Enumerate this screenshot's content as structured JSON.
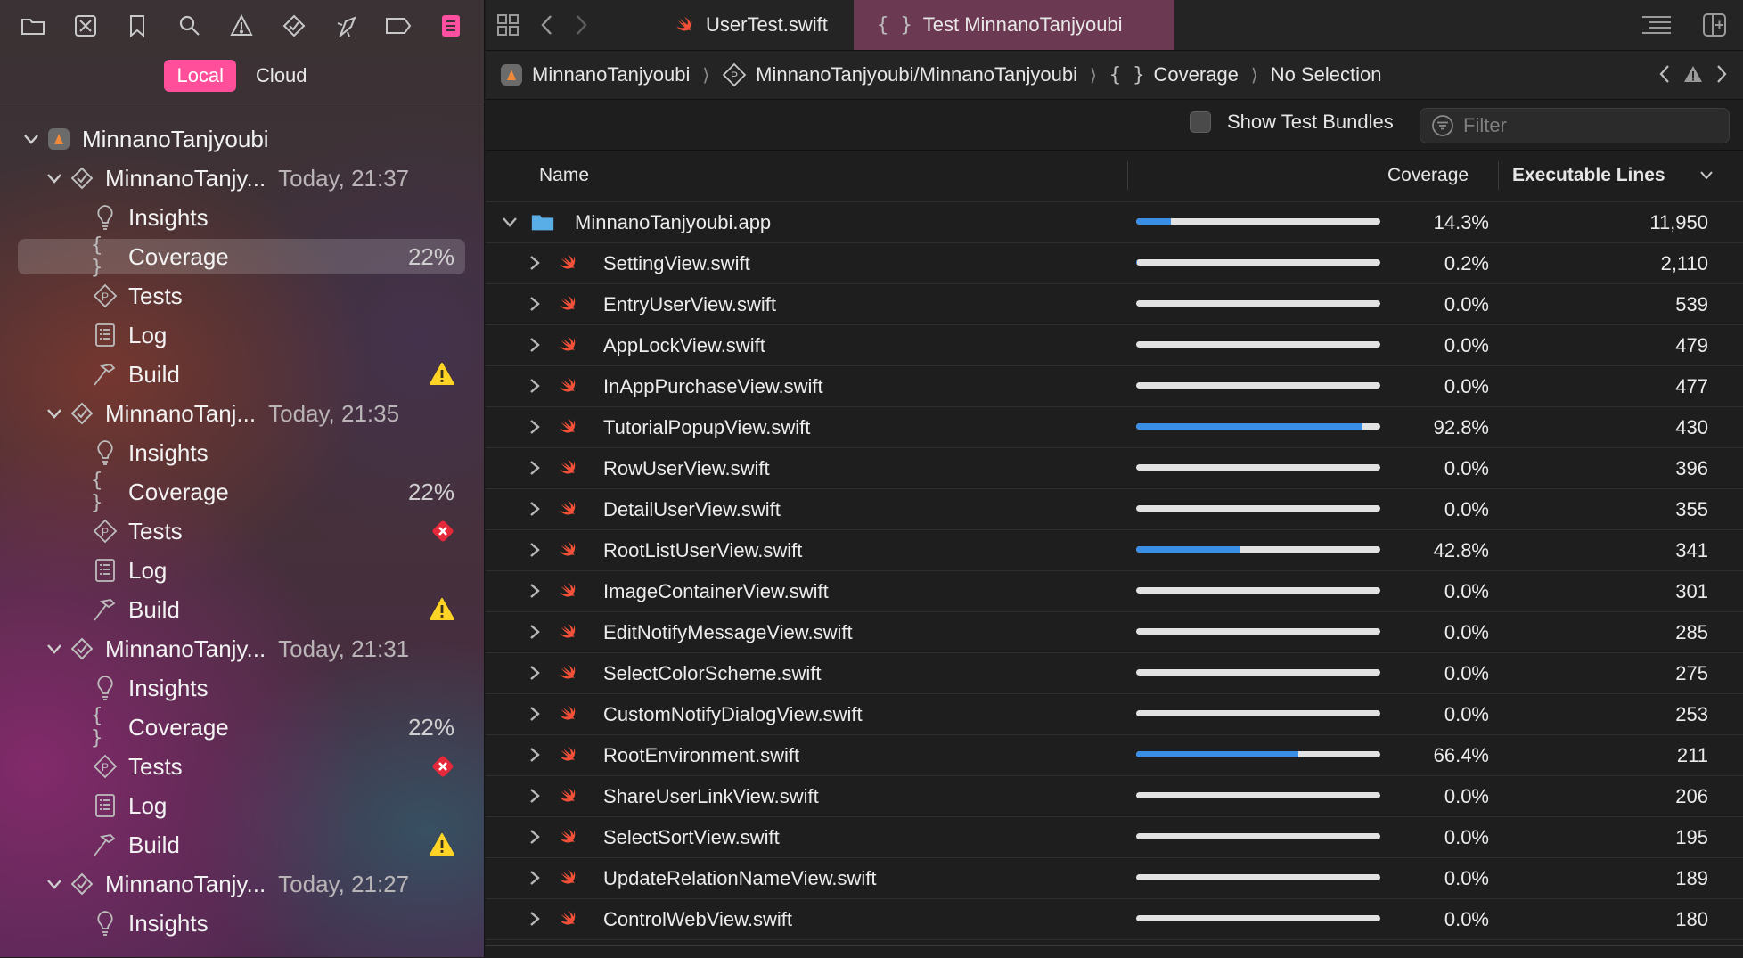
{
  "sidebar": {
    "nav_icons": [
      "folder-icon",
      "source-control-icon",
      "bookmark-icon",
      "search-icon",
      "warning-icon",
      "test-icon",
      "debug-icon",
      "breakpoint-icon",
      "report-icon"
    ],
    "scope": {
      "local": "Local",
      "cloud": "Cloud",
      "selected": "Local"
    },
    "project": "MinnanoTanjyoubi",
    "runs": [
      {
        "name": "MinnanoTanjy...",
        "time": "Today, 21:37",
        "items": [
          {
            "label": "Insights",
            "icon": "lightbulb-icon"
          },
          {
            "label": "Coverage",
            "icon": "braces-icon",
            "value": "22%",
            "selected": true
          },
          {
            "label": "Tests",
            "icon": "test-plan-icon"
          },
          {
            "label": "Log",
            "icon": "log-icon"
          },
          {
            "label": "Build",
            "icon": "hammer-icon",
            "status": "warning"
          }
        ]
      },
      {
        "name": "MinnanoTanj...",
        "time": "Today, 21:35",
        "items": [
          {
            "label": "Insights",
            "icon": "lightbulb-icon"
          },
          {
            "label": "Coverage",
            "icon": "braces-icon",
            "value": "22%"
          },
          {
            "label": "Tests",
            "icon": "test-plan-icon",
            "status": "error"
          },
          {
            "label": "Log",
            "icon": "log-icon"
          },
          {
            "label": "Build",
            "icon": "hammer-icon",
            "status": "warning"
          }
        ]
      },
      {
        "name": "MinnanoTanjy...",
        "time": "Today, 21:31",
        "items": [
          {
            "label": "Insights",
            "icon": "lightbulb-icon"
          },
          {
            "label": "Coverage",
            "icon": "braces-icon",
            "value": "22%"
          },
          {
            "label": "Tests",
            "icon": "test-plan-icon",
            "status": "error"
          },
          {
            "label": "Log",
            "icon": "log-icon"
          },
          {
            "label": "Build",
            "icon": "hammer-icon",
            "status": "warning"
          }
        ]
      },
      {
        "name": "MinnanoTanjy...",
        "time": "Today, 21:27",
        "items": [
          {
            "label": "Insights",
            "icon": "lightbulb-icon"
          }
        ]
      }
    ]
  },
  "tabs": [
    {
      "label": "UserTest.swift",
      "icon": "swift-icon",
      "active": false
    },
    {
      "label": "Test MinnanoTanjyoubi",
      "icon": "braces-icon",
      "active": true
    }
  ],
  "jumpbar": {
    "crumbs": [
      {
        "label": "MinnanoTanjyoubi",
        "icon": "app-icon"
      },
      {
        "label": "MinnanoTanjyoubi/MinnanoTanjyoubi",
        "icon": "test-plan-icon"
      },
      {
        "label": "Coverage",
        "icon": "braces-icon"
      },
      {
        "label": "No Selection",
        "icon": ""
      }
    ]
  },
  "filterbar": {
    "show_bundles": "Show Test Bundles",
    "filter_placeholder": "Filter"
  },
  "table": {
    "columns": {
      "name": "Name",
      "coverage": "Coverage",
      "lines": "Executable Lines"
    },
    "target": {
      "name": "MinnanoTanjyoubi.app",
      "coverage": "14.3%",
      "coverage_fraction": 0.143,
      "lines": "11,950"
    },
    "files": [
      {
        "name": "SettingView.swift",
        "coverage": "0.2%",
        "coverage_fraction": 0.002,
        "lines": "2,110"
      },
      {
        "name": "EntryUserView.swift",
        "coverage": "0.0%",
        "coverage_fraction": 0,
        "lines": "539"
      },
      {
        "name": "AppLockView.swift",
        "coverage": "0.0%",
        "coverage_fraction": 0,
        "lines": "479"
      },
      {
        "name": "InAppPurchaseView.swift",
        "coverage": "0.0%",
        "coverage_fraction": 0,
        "lines": "477"
      },
      {
        "name": "TutorialPopupView.swift",
        "coverage": "92.8%",
        "coverage_fraction": 0.928,
        "lines": "430"
      },
      {
        "name": "RowUserView.swift",
        "coverage": "0.0%",
        "coverage_fraction": 0,
        "lines": "396"
      },
      {
        "name": "DetailUserView.swift",
        "coverage": "0.0%",
        "coverage_fraction": 0,
        "lines": "355"
      },
      {
        "name": "RootListUserView.swift",
        "coverage": "42.8%",
        "coverage_fraction": 0.428,
        "lines": "341"
      },
      {
        "name": "ImageContainerView.swift",
        "coverage": "0.0%",
        "coverage_fraction": 0,
        "lines": "301"
      },
      {
        "name": "EditNotifyMessageView.swift",
        "coverage": "0.0%",
        "coverage_fraction": 0,
        "lines": "285"
      },
      {
        "name": "SelectColorScheme.swift",
        "coverage": "0.0%",
        "coverage_fraction": 0,
        "lines": "275"
      },
      {
        "name": "CustomNotifyDialogView.swift",
        "coverage": "0.0%",
        "coverage_fraction": 0,
        "lines": "253"
      },
      {
        "name": "RootEnvironment.swift",
        "coverage": "66.4%",
        "coverage_fraction": 0.664,
        "lines": "211"
      },
      {
        "name": "ShareUserLinkView.swift",
        "coverage": "0.0%",
        "coverage_fraction": 0,
        "lines": "206"
      },
      {
        "name": "SelectSortView.swift",
        "coverage": "0.0%",
        "coverage_fraction": 0,
        "lines": "195"
      },
      {
        "name": "UpdateRelationNameView.swift",
        "coverage": "0.0%",
        "coverage_fraction": 0,
        "lines": "189"
      },
      {
        "name": "ControlWebView.swift",
        "coverage": "0.0%",
        "coverage_fraction": 0,
        "lines": "180"
      }
    ]
  },
  "colors": {
    "accent": "#ff4f9b",
    "coverage_fill": "#3a8ee6",
    "coverage_track": "#e2e2e2",
    "warning": "#ffd426",
    "error": "#e5283a",
    "swift": "#f05138",
    "active_tab": "#6b3952"
  }
}
